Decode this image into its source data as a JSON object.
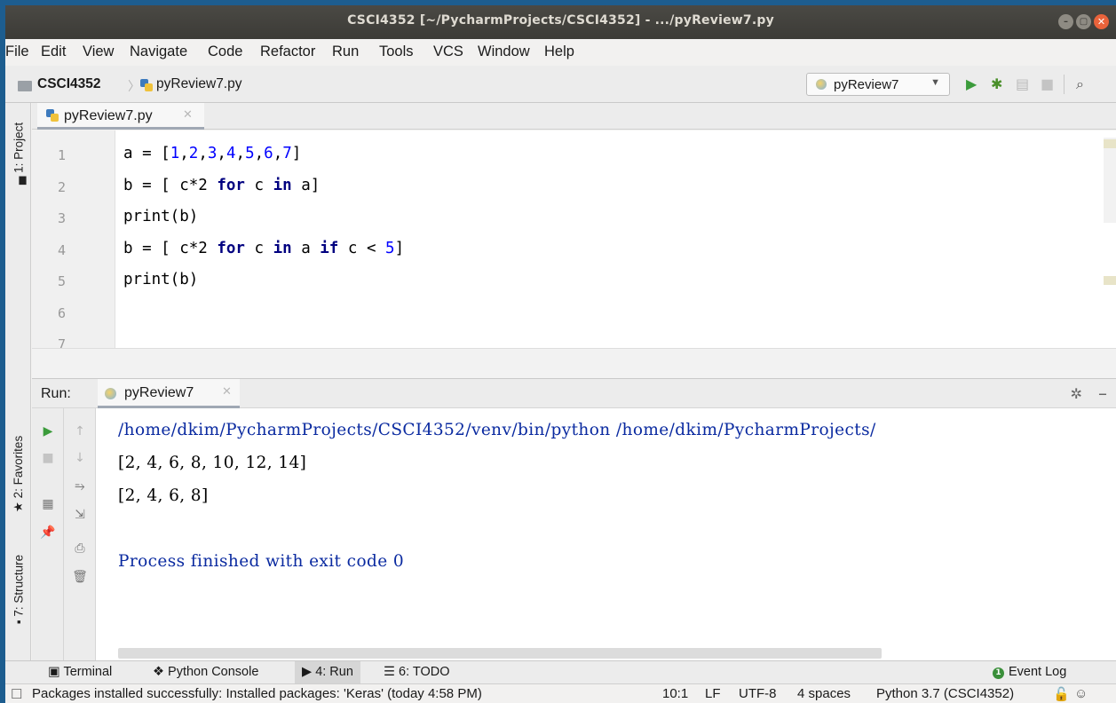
{
  "window": {
    "title": "CSCI4352 [~/PycharmProjects/CSCI4352] - .../pyReview7.py"
  },
  "menu": [
    "File",
    "Edit",
    "View",
    "Navigate",
    "Code",
    "Refactor",
    "Run",
    "Tools",
    "VCS",
    "Window",
    "Help"
  ],
  "breadcrumb": {
    "project": "CSCI4352",
    "file": "pyReview7.py"
  },
  "toolbar": {
    "run_config": "pyReview7"
  },
  "left_tools": {
    "project": "1: Project",
    "favorites": "2: Favorites",
    "structure": "7: Structure"
  },
  "editor_tab": {
    "name": "pyReview7.py"
  },
  "editor": {
    "line_numbers": [
      "1",
      "2",
      "3",
      "4",
      "5",
      "6",
      "7"
    ]
  },
  "run_panel": {
    "label": "Run:",
    "tab": "pyReview7",
    "output": [
      "/home/dkim/PycharmProjects/CSCI4352/venv/bin/python /home/dkim/PycharmProjects/",
      "[2, 4, 6, 8, 10, 12, 14]",
      "[2, 4, 6, 8]",
      "Process finished with exit code 0"
    ]
  },
  "tool_tabs": {
    "terminal": "Terminal",
    "python_console": "Python Console",
    "run": "4: Run",
    "todo": "6: TODO",
    "event_log": "Event Log"
  },
  "status": {
    "message": "Packages installed successfully: Installed packages: 'Keras' (today 4:58 PM)",
    "position": "10:1",
    "line_sep": "LF",
    "encoding": "UTF-8",
    "indent": "4 spaces",
    "interpreter": "Python 3.7 (CSCI4352)"
  }
}
